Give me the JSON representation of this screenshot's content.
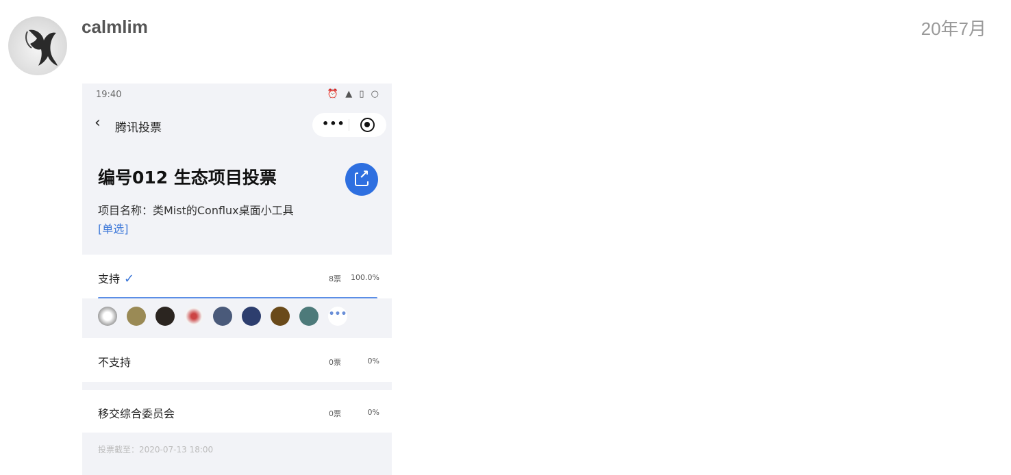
{
  "post": {
    "username": "calmlim",
    "date": "20年7月"
  },
  "phone": {
    "status_time": "19:40",
    "status_icons": "⏰ ▲ ▯ ○",
    "back_icon": "‹",
    "nav_title": "腾讯投票",
    "capsule_more": "•••",
    "vote_title": "编号012 生态项目投票",
    "description": "项目名称：类Mist的Conflux桌面小工具",
    "mode": "[单选]",
    "options": [
      {
        "label": "支持",
        "votes": "8票",
        "percent": "100.0%",
        "selected": true
      },
      {
        "label": "不支持",
        "votes": "0票",
        "percent": "0%",
        "selected": false
      },
      {
        "label": "移交综合委员会",
        "votes": "0票",
        "percent": "0%",
        "selected": false
      }
    ],
    "check_icon": "✓",
    "voters_more": "•••",
    "deadline": "投票截至：2020-07-13 18:00"
  },
  "colors": {
    "accent": "#2e6fe0",
    "link": "#3a76d8",
    "phone_bg": "#f2f3f7"
  },
  "icons": [
    "avatar-bird-image",
    "back-chevron-icon",
    "more-dots-icon",
    "target-icon",
    "share-icon",
    "check-icon"
  ]
}
